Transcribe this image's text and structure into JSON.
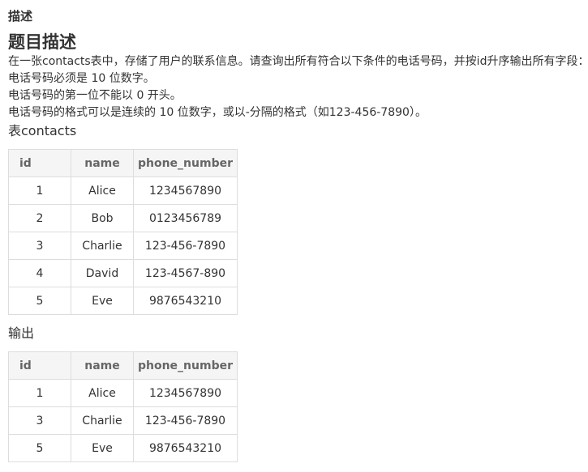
{
  "section_label": "描述",
  "title": "题目描述",
  "paragraphs": [
    "在一张contacts表中，存储了用户的联系信息。请查询出所有符合以下条件的电话号码，并按id升序输出所有字段：",
    "电话号码必须是 10 位数字。",
    "电话号码的第一位不能以 0 开头。",
    "电话号码的格式可以是连续的 10 位数字，或以-分隔的格式（如123-456-7890）。"
  ],
  "input_table": {
    "heading": "表contacts",
    "columns": [
      "id",
      "name",
      "phone_number"
    ],
    "rows": [
      [
        "1",
        "Alice",
        "1234567890"
      ],
      [
        "2",
        "Bob",
        "0123456789"
      ],
      [
        "3",
        "Charlie",
        "123-456-7890"
      ],
      [
        "4",
        "David",
        "123-4567-890"
      ],
      [
        "5",
        "Eve",
        "9876543210"
      ]
    ]
  },
  "output_table": {
    "heading": "输出",
    "columns": [
      "id",
      "name",
      "phone_number"
    ],
    "rows": [
      [
        "1",
        "Alice",
        "1234567890"
      ],
      [
        "3",
        "Charlie",
        "123-456-7890"
      ],
      [
        "5",
        "Eve",
        "9876543210"
      ]
    ]
  }
}
